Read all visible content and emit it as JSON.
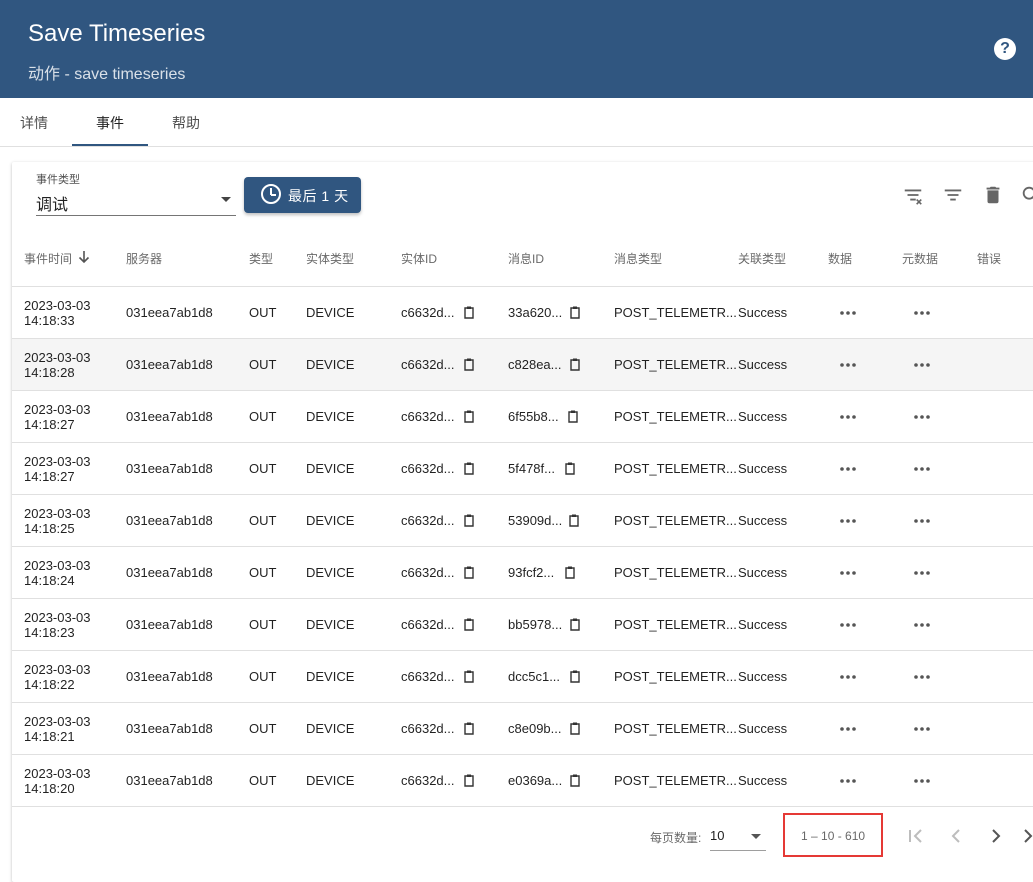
{
  "header": {
    "title": "Save Timeseries",
    "subtitle": "动作 - save timeseries",
    "help_icon": "help-circle-icon"
  },
  "tabs": [
    {
      "label": "详情",
      "active": false
    },
    {
      "label": "事件",
      "active": true
    },
    {
      "label": "帮助",
      "active": false
    }
  ],
  "filter": {
    "event_type_label": "事件类型",
    "event_type_value": "调试",
    "time_button_label": "最后 1 天"
  },
  "columns": [
    "事件时间",
    "服务器",
    "类型",
    "实体类型",
    "实体ID",
    "消息ID",
    "消息类型",
    "关联类型",
    "数据",
    "元数据",
    "错误"
  ],
  "rows": [
    {
      "date": "2023-03-03",
      "time": "14:18:33",
      "server": "031eea7ab1d8",
      "type": "OUT",
      "entity_type": "DEVICE",
      "entity_id": "c6632d...",
      "msg_id": "33a620...",
      "msg_type": "POST_TELEMETR...",
      "relation": "Success"
    },
    {
      "date": "2023-03-03",
      "time": "14:18:28",
      "server": "031eea7ab1d8",
      "type": "OUT",
      "entity_type": "DEVICE",
      "entity_id": "c6632d...",
      "msg_id": "c828ea...",
      "msg_type": "POST_TELEMETR...",
      "relation": "Success"
    },
    {
      "date": "2023-03-03",
      "time": "14:18:27",
      "server": "031eea7ab1d8",
      "type": "OUT",
      "entity_type": "DEVICE",
      "entity_id": "c6632d...",
      "msg_id": "6f55b8...",
      "msg_type": "POST_TELEMETR...",
      "relation": "Success"
    },
    {
      "date": "2023-03-03",
      "time": "14:18:27",
      "server": "031eea7ab1d8",
      "type": "OUT",
      "entity_type": "DEVICE",
      "entity_id": "c6632d...",
      "msg_id": "5f478f...",
      "msg_type": "POST_TELEMETR...",
      "relation": "Success"
    },
    {
      "date": "2023-03-03",
      "time": "14:18:25",
      "server": "031eea7ab1d8",
      "type": "OUT",
      "entity_type": "DEVICE",
      "entity_id": "c6632d...",
      "msg_id": "53909d...",
      "msg_type": "POST_TELEMETR...",
      "relation": "Success"
    },
    {
      "date": "2023-03-03",
      "time": "14:18:24",
      "server": "031eea7ab1d8",
      "type": "OUT",
      "entity_type": "DEVICE",
      "entity_id": "c6632d...",
      "msg_id": "93fcf2...",
      "msg_type": "POST_TELEMETR...",
      "relation": "Success"
    },
    {
      "date": "2023-03-03",
      "time": "14:18:23",
      "server": "031eea7ab1d8",
      "type": "OUT",
      "entity_type": "DEVICE",
      "entity_id": "c6632d...",
      "msg_id": "bb5978...",
      "msg_type": "POST_TELEMETR...",
      "relation": "Success"
    },
    {
      "date": "2023-03-03",
      "time": "14:18:22",
      "server": "031eea7ab1d8",
      "type": "OUT",
      "entity_type": "DEVICE",
      "entity_id": "c6632d...",
      "msg_id": "dcc5c1...",
      "msg_type": "POST_TELEMETR...",
      "relation": "Success"
    },
    {
      "date": "2023-03-03",
      "time": "14:18:21",
      "server": "031eea7ab1d8",
      "type": "OUT",
      "entity_type": "DEVICE",
      "entity_id": "c6632d...",
      "msg_id": "c8e09b...",
      "msg_type": "POST_TELEMETR...",
      "relation": "Success"
    },
    {
      "date": "2023-03-03",
      "time": "14:18:20",
      "server": "031eea7ab1d8",
      "type": "OUT",
      "entity_type": "DEVICE",
      "entity_id": "c6632d...",
      "msg_id": "e0369a...",
      "msg_type": "POST_TELEMETR...",
      "relation": "Success"
    }
  ],
  "paginator": {
    "page_size_label": "每页数量:",
    "page_size": "10",
    "range": "1 – 10 - 610"
  },
  "colors": {
    "header_bg": "#305680",
    "highlight_box": "#e53935"
  }
}
